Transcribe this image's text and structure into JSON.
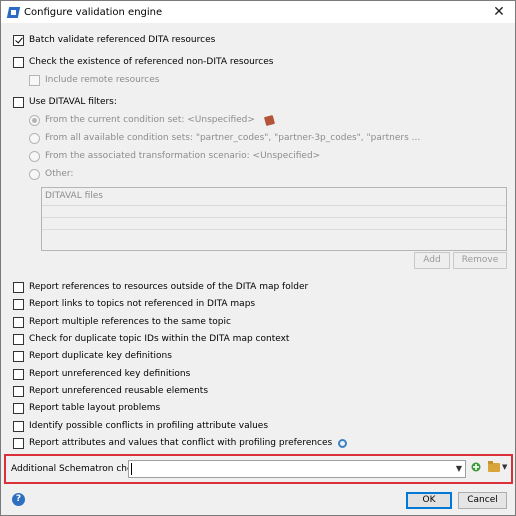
{
  "window": {
    "title": "Configure validation engine",
    "close_glyph": "✕"
  },
  "options": {
    "batch_validate": {
      "label": "Batch validate referenced DITA resources",
      "checked": true
    },
    "check_existence": {
      "label": "Check the existence of referenced non-DITA resources",
      "checked": false
    },
    "include_remote": {
      "label": "Include remote resources",
      "checked": false,
      "enabled": false
    },
    "use_ditaval": {
      "label": "Use DITAVAL filters:",
      "checked": false
    }
  },
  "ditaval": {
    "radio_current": "From the current condition set: <Unspecified>",
    "radio_all_sets": "From all available condition sets: \"partner_codes\", \"partner-3p_codes\", \"partners ...",
    "radio_transformation": "From the associated transformation scenario: <Unspecified>",
    "radio_other": "Other:",
    "files_header": "DITAVAL files",
    "add_button": "Add",
    "remove_button": "Remove"
  },
  "reports": [
    {
      "label": "Report references to resources outside of the DITA map folder",
      "checked": false
    },
    {
      "label": "Report links to topics not referenced in DITA maps",
      "checked": false
    },
    {
      "label": "Report multiple references to the same topic",
      "checked": false
    },
    {
      "label": "Check for duplicate topic IDs within the DITA map context",
      "checked": false
    },
    {
      "label": "Report duplicate key definitions",
      "checked": false
    },
    {
      "label": "Report unreferenced key definitions",
      "checked": false
    },
    {
      "label": "Report unreferenced reusable elements",
      "checked": false
    },
    {
      "label": "Report table layout problems",
      "checked": false
    },
    {
      "label": "Identify possible conflicts in profiling attribute values",
      "checked": false
    },
    {
      "label": "Report attributes and values that conflict with profiling preferences",
      "checked": false
    }
  ],
  "schematron": {
    "label": "Additional Schematron checks:",
    "value": ""
  },
  "footer": {
    "ok": "OK",
    "cancel": "Cancel",
    "help_glyph": "?"
  },
  "colors": {
    "highlight_border": "#d9303a",
    "primary_button_border": "#0078d7"
  }
}
